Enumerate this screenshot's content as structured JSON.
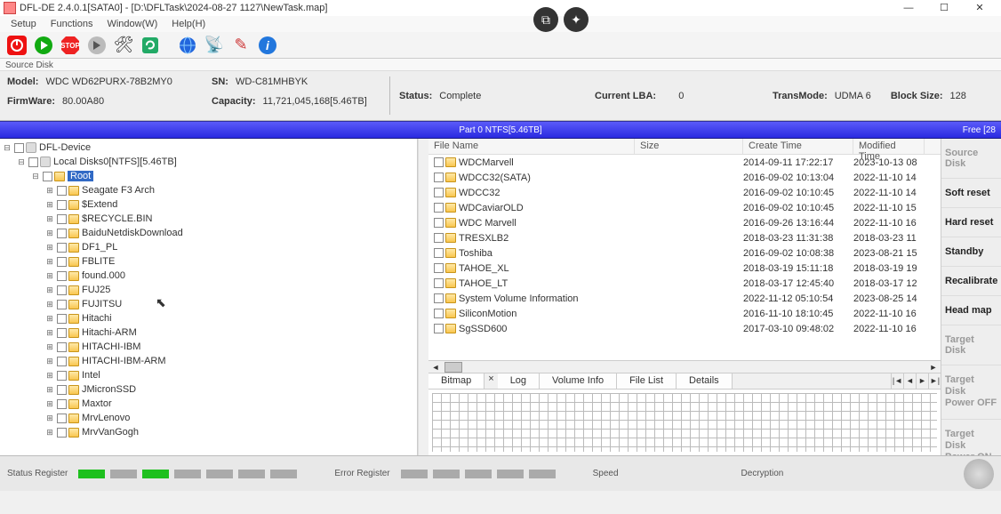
{
  "title": "DFL-DE 2.4.0.1[SATA0] - [D:\\DFLTask\\2024-08-27 1127\\NewTask.map]",
  "menu": [
    "Setup",
    "Functions",
    "Window(W)",
    "Help(H)"
  ],
  "srcdisk_label": "Source Disk",
  "info": {
    "model_lbl": "Model:",
    "model": "WDC WD62PURX-78B2MY0",
    "sn_lbl": "SN:",
    "sn": "WD-C81MHBYK",
    "fw_lbl": "FirmWare:",
    "fw": "80.00A80",
    "cap_lbl": "Capacity:",
    "cap": "11,721,045,168[5.46TB]",
    "status_lbl": "Status:",
    "status": "Complete",
    "lba_lbl": "Current LBA:",
    "lba": "0",
    "tm_lbl": "TransMode:",
    "tm": "UDMA 6",
    "bs_lbl": "Block Size:",
    "bs": "128"
  },
  "partition": "Part 0 NTFS[5.46TB]",
  "free_lbl": "Free [28",
  "tree_root": "DFL-Device",
  "tree_disk": "Local Disks0[NTFS][5.46TB]",
  "tree_sel": "Root",
  "tree_items": [
    "Seagate F3 Arch",
    "$Extend",
    "$RECYCLE.BIN",
    "BaiduNetdiskDownload",
    "DF1_PL",
    "FBLITE",
    "found.000",
    "FUJ25",
    "FUJITSU",
    "Hitachi",
    "Hitachi-ARM",
    "HITACHI-IBM",
    "HITACHI-IBM-ARM",
    "Intel",
    "JMicronSSD",
    "Maxtor",
    "MrvLenovo",
    "MrvVanGogh"
  ],
  "cols": {
    "name": "File Name",
    "size": "Size",
    "create": "Create Time",
    "mod": "Modified Time"
  },
  "files": [
    {
      "n": "WDCMarvell",
      "c": "2014-09-11  17:22:17",
      "m": "2023-10-13  08"
    },
    {
      "n": "WDCC32(SATA)",
      "c": "2016-09-02  10:13:04",
      "m": "2022-11-10  14"
    },
    {
      "n": "WDCC32",
      "c": "2016-09-02  10:10:45",
      "m": "2022-11-10  14"
    },
    {
      "n": "WDCaviarOLD",
      "c": "2016-09-02  10:10:45",
      "m": "2022-11-10  15"
    },
    {
      "n": "WDC Marvell",
      "c": "2016-09-26  13:16:44",
      "m": "2022-11-10  16"
    },
    {
      "n": "TRESXLB2",
      "c": "2018-03-23  11:31:38",
      "m": "2018-03-23  11"
    },
    {
      "n": "Toshiba",
      "c": "2016-09-02  10:08:38",
      "m": "2023-08-21  15"
    },
    {
      "n": "TAHOE_XL",
      "c": "2018-03-19  15:11:18",
      "m": "2018-03-19  19"
    },
    {
      "n": "TAHOE_LT",
      "c": "2018-03-17  12:45:40",
      "m": "2018-03-17  12"
    },
    {
      "n": "System Volume Information",
      "c": "2022-11-12  05:10:54",
      "m": "2023-08-25  14"
    },
    {
      "n": "SiliconMotion",
      "c": "2016-11-10  18:10:45",
      "m": "2022-11-10  16"
    },
    {
      "n": "SgSSD600",
      "c": "2017-03-10  09:48:02",
      "m": "2022-11-10  16"
    }
  ],
  "tabs": [
    "Bitmap",
    "Log",
    "Volume Info",
    "File List",
    "Details"
  ],
  "sidebtns": [
    {
      "t": "Source Disk",
      "dim": true
    },
    {
      "t": "Soft reset"
    },
    {
      "t": "Hard reset"
    },
    {
      "t": "Standby"
    },
    {
      "t": "Recalibrate"
    },
    {
      "t": "Head map"
    },
    {
      "t": "Target Disk",
      "dim": true
    },
    {
      "t": "Target Disk Power OFF",
      "two": true,
      "dim": true
    },
    {
      "t": "Target Disk Power ON",
      "two": true,
      "dim": true
    }
  ],
  "status": {
    "sr": "Status Register",
    "er": "Error Register",
    "sp": "Speed",
    "de": "Decryption"
  }
}
